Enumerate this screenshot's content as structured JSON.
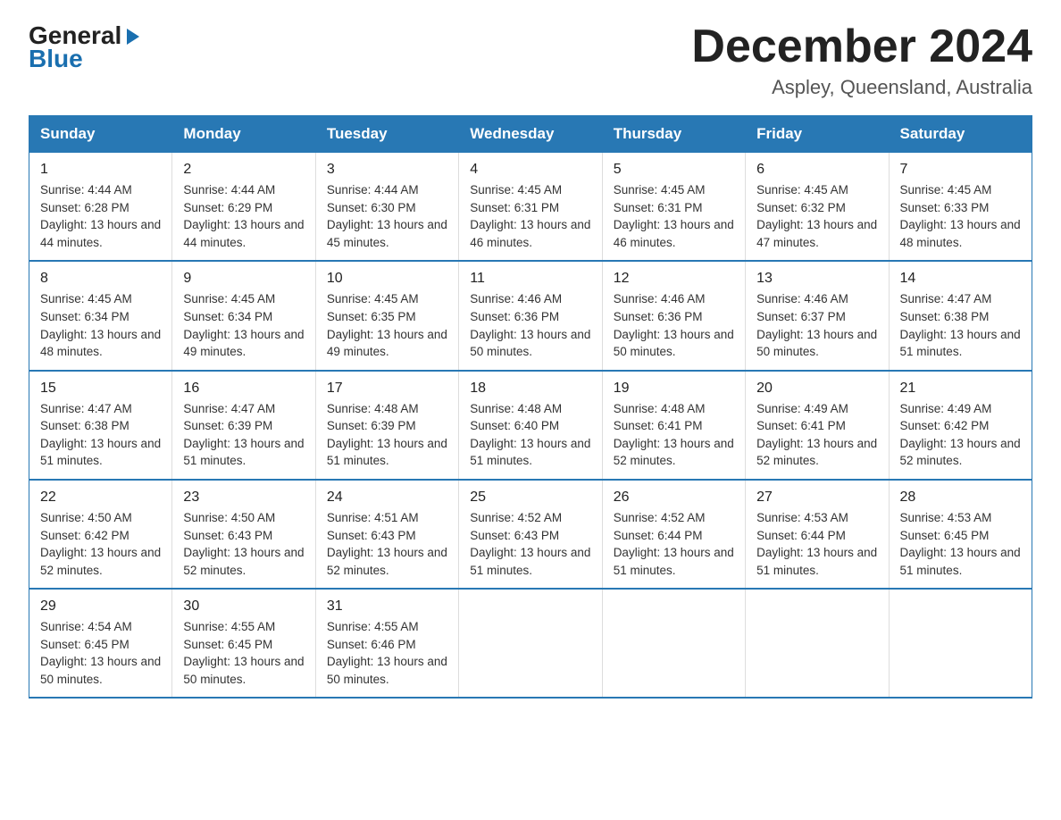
{
  "header": {
    "logo_general": "General",
    "logo_blue": "Blue",
    "month_title": "December 2024",
    "location": "Aspley, Queensland, Australia"
  },
  "days_of_week": [
    "Sunday",
    "Monday",
    "Tuesday",
    "Wednesday",
    "Thursday",
    "Friday",
    "Saturday"
  ],
  "weeks": [
    [
      {
        "day": "1",
        "sunrise": "4:44 AM",
        "sunset": "6:28 PM",
        "daylight": "13 hours and 44 minutes."
      },
      {
        "day": "2",
        "sunrise": "4:44 AM",
        "sunset": "6:29 PM",
        "daylight": "13 hours and 44 minutes."
      },
      {
        "day": "3",
        "sunrise": "4:44 AM",
        "sunset": "6:30 PM",
        "daylight": "13 hours and 45 minutes."
      },
      {
        "day": "4",
        "sunrise": "4:45 AM",
        "sunset": "6:31 PM",
        "daylight": "13 hours and 46 minutes."
      },
      {
        "day": "5",
        "sunrise": "4:45 AM",
        "sunset": "6:31 PM",
        "daylight": "13 hours and 46 minutes."
      },
      {
        "day": "6",
        "sunrise": "4:45 AM",
        "sunset": "6:32 PM",
        "daylight": "13 hours and 47 minutes."
      },
      {
        "day": "7",
        "sunrise": "4:45 AM",
        "sunset": "6:33 PM",
        "daylight": "13 hours and 48 minutes."
      }
    ],
    [
      {
        "day": "8",
        "sunrise": "4:45 AM",
        "sunset": "6:34 PM",
        "daylight": "13 hours and 48 minutes."
      },
      {
        "day": "9",
        "sunrise": "4:45 AM",
        "sunset": "6:34 PM",
        "daylight": "13 hours and 49 minutes."
      },
      {
        "day": "10",
        "sunrise": "4:45 AM",
        "sunset": "6:35 PM",
        "daylight": "13 hours and 49 minutes."
      },
      {
        "day": "11",
        "sunrise": "4:46 AM",
        "sunset": "6:36 PM",
        "daylight": "13 hours and 50 minutes."
      },
      {
        "day": "12",
        "sunrise": "4:46 AM",
        "sunset": "6:36 PM",
        "daylight": "13 hours and 50 minutes."
      },
      {
        "day": "13",
        "sunrise": "4:46 AM",
        "sunset": "6:37 PM",
        "daylight": "13 hours and 50 minutes."
      },
      {
        "day": "14",
        "sunrise": "4:47 AM",
        "sunset": "6:38 PM",
        "daylight": "13 hours and 51 minutes."
      }
    ],
    [
      {
        "day": "15",
        "sunrise": "4:47 AM",
        "sunset": "6:38 PM",
        "daylight": "13 hours and 51 minutes."
      },
      {
        "day": "16",
        "sunrise": "4:47 AM",
        "sunset": "6:39 PM",
        "daylight": "13 hours and 51 minutes."
      },
      {
        "day": "17",
        "sunrise": "4:48 AM",
        "sunset": "6:39 PM",
        "daylight": "13 hours and 51 minutes."
      },
      {
        "day": "18",
        "sunrise": "4:48 AM",
        "sunset": "6:40 PM",
        "daylight": "13 hours and 51 minutes."
      },
      {
        "day": "19",
        "sunrise": "4:48 AM",
        "sunset": "6:41 PM",
        "daylight": "13 hours and 52 minutes."
      },
      {
        "day": "20",
        "sunrise": "4:49 AM",
        "sunset": "6:41 PM",
        "daylight": "13 hours and 52 minutes."
      },
      {
        "day": "21",
        "sunrise": "4:49 AM",
        "sunset": "6:42 PM",
        "daylight": "13 hours and 52 minutes."
      }
    ],
    [
      {
        "day": "22",
        "sunrise": "4:50 AM",
        "sunset": "6:42 PM",
        "daylight": "13 hours and 52 minutes."
      },
      {
        "day": "23",
        "sunrise": "4:50 AM",
        "sunset": "6:43 PM",
        "daylight": "13 hours and 52 minutes."
      },
      {
        "day": "24",
        "sunrise": "4:51 AM",
        "sunset": "6:43 PM",
        "daylight": "13 hours and 52 minutes."
      },
      {
        "day": "25",
        "sunrise": "4:52 AM",
        "sunset": "6:43 PM",
        "daylight": "13 hours and 51 minutes."
      },
      {
        "day": "26",
        "sunrise": "4:52 AM",
        "sunset": "6:44 PM",
        "daylight": "13 hours and 51 minutes."
      },
      {
        "day": "27",
        "sunrise": "4:53 AM",
        "sunset": "6:44 PM",
        "daylight": "13 hours and 51 minutes."
      },
      {
        "day": "28",
        "sunrise": "4:53 AM",
        "sunset": "6:45 PM",
        "daylight": "13 hours and 51 minutes."
      }
    ],
    [
      {
        "day": "29",
        "sunrise": "4:54 AM",
        "sunset": "6:45 PM",
        "daylight": "13 hours and 50 minutes."
      },
      {
        "day": "30",
        "sunrise": "4:55 AM",
        "sunset": "6:45 PM",
        "daylight": "13 hours and 50 minutes."
      },
      {
        "day": "31",
        "sunrise": "4:55 AM",
        "sunset": "6:46 PM",
        "daylight": "13 hours and 50 minutes."
      },
      null,
      null,
      null,
      null
    ]
  ]
}
